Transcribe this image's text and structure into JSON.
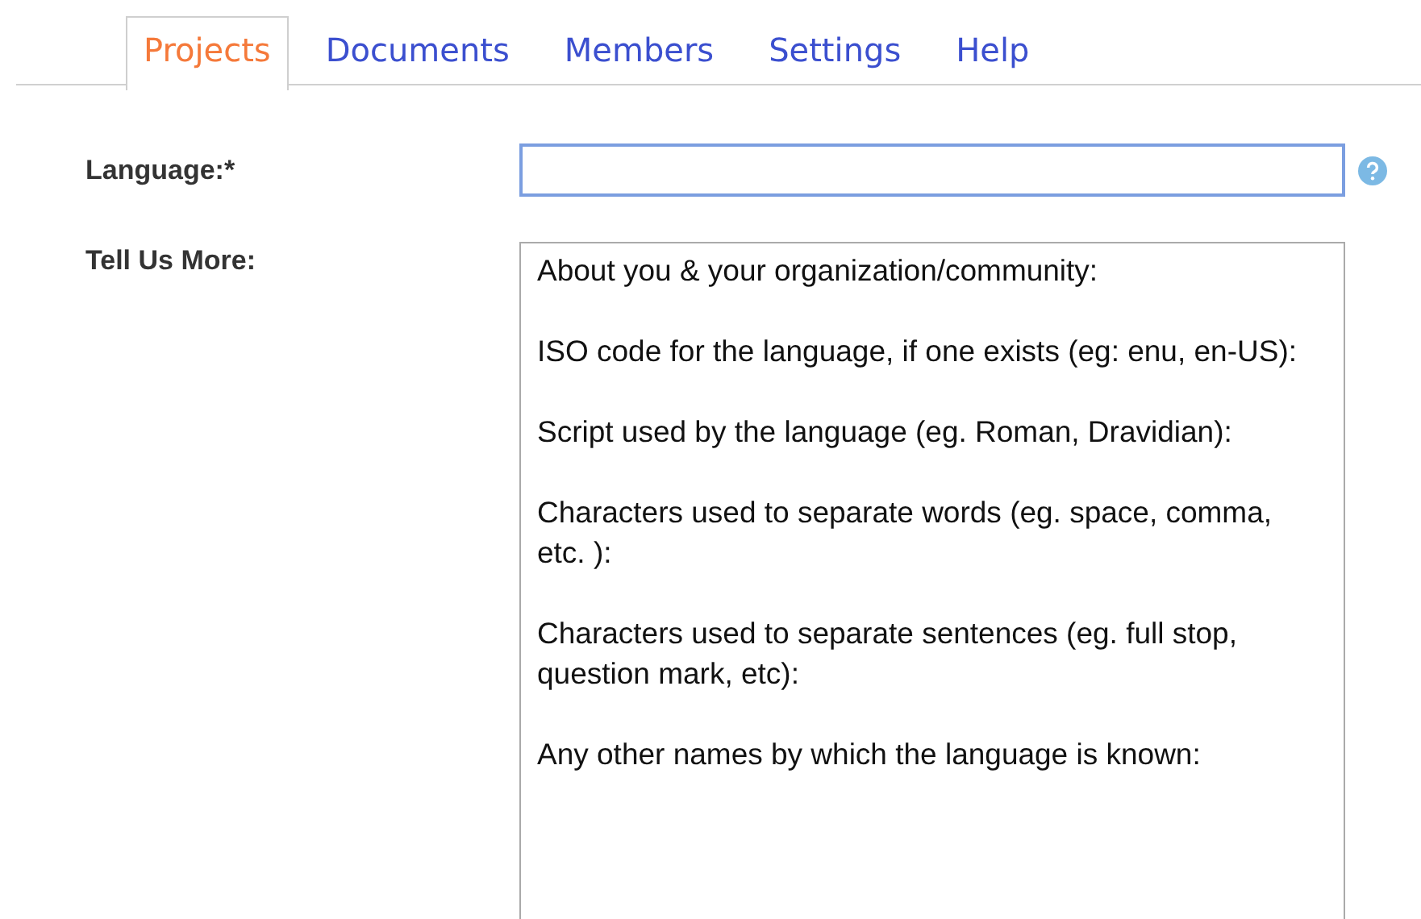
{
  "tabs": [
    {
      "label": "Projects",
      "selected": true
    },
    {
      "label": "Documents",
      "selected": false
    },
    {
      "label": "Members",
      "selected": false
    },
    {
      "label": "Settings",
      "selected": false
    },
    {
      "label": "Help",
      "selected": false
    }
  ],
  "form": {
    "fields": [
      {
        "kind": "input",
        "label": "Language:*",
        "focused": true,
        "help": true
      },
      {
        "kind": "textarea",
        "label": "Tell Us More:",
        "value": "About you & your organization/community:\n\nISO code for the language, if one exists (eg: enu, en-US):\n\nScript used by the language (eg. Roman, Dravidian):\n\nCharacters used to separate words (eg. space, comma, etc. ):\n\nCharacters used to separate sentences (eg. full stop,  question mark, etc):\n\nAny other names by which the language is known:"
      }
    ]
  }
}
